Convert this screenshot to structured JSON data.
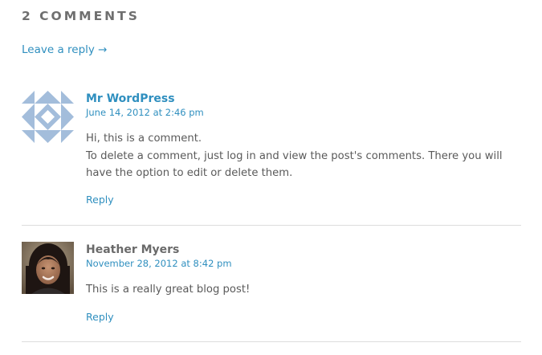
{
  "comments_section": {
    "title": "2 COMMENTS",
    "leave_reply": "Leave a reply →"
  },
  "comments": [
    {
      "author": "Mr WordPress",
      "date": "June 14, 2012 at 2:46 pm",
      "paragraphs": [
        "Hi, this is a comment.",
        "To delete a comment, just log in and view the post's comments. There you will have the option to edit or delete them."
      ],
      "reply_label": "Reply",
      "avatar_icon": "identicon-avatar-icon",
      "avatar_colors": {
        "primary": "#a3bddb",
        "secondary": "#ffffff"
      }
    },
    {
      "author": "Heather Myers",
      "date": "November 28, 2012 at 8:42 pm",
      "paragraphs": [
        "This is a really great blog post!"
      ],
      "reply_label": "Reply",
      "avatar_icon": "user-photo-avatar-icon"
    }
  ],
  "colors": {
    "link": "#2f8fbf",
    "text": "#5a5a5a",
    "heading": "#6f6f6f",
    "divider": "#dcdcdc"
  }
}
